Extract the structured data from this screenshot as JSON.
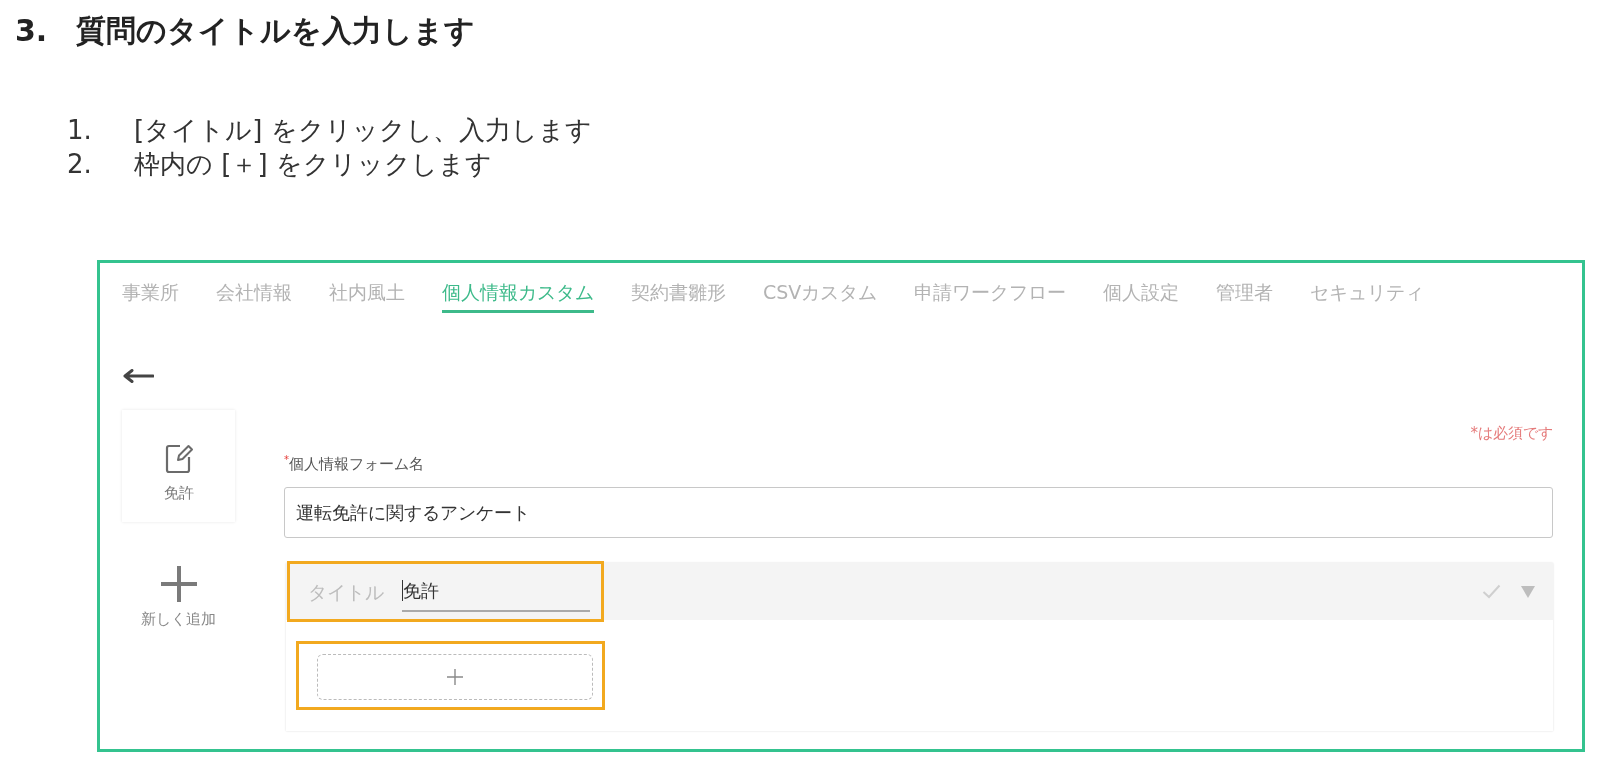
{
  "heading": {
    "number": "3.",
    "title": "質問のタイトルを入力します"
  },
  "steps": [
    {
      "number": "1.",
      "text": "[タイトル] をクリックし、入力します"
    },
    {
      "number": "2.",
      "text": "枠内の [＋] をクリックします"
    }
  ],
  "screenshot": {
    "tabs": [
      {
        "label": "事業所",
        "selected": false
      },
      {
        "label": "会社情報",
        "selected": false
      },
      {
        "label": "社内風土",
        "selected": false
      },
      {
        "label": "個人情報カスタム",
        "selected": true
      },
      {
        "label": "契約書雛形",
        "selected": false
      },
      {
        "label": "CSVカスタム",
        "selected": false
      },
      {
        "label": "申請ワークフロー",
        "selected": false
      },
      {
        "label": "個人設定",
        "selected": false
      },
      {
        "label": "管理者",
        "selected": false
      },
      {
        "label": "セキュリティ",
        "selected": false
      }
    ],
    "forms": [
      {
        "label": "免許"
      }
    ],
    "add_new": {
      "label": "新しく追加"
    },
    "required_note": "*は必須です",
    "form_name": {
      "label": "$^{*}$個人情報フォーム名",
      "value": "運転免許に関するアンケート"
    },
    "question": {
      "title_label": "タイトル",
      "title_value": "免許",
      "focused": true,
      "title_highlighted": true,
      "add_highlighted": true
    }
  }
}
